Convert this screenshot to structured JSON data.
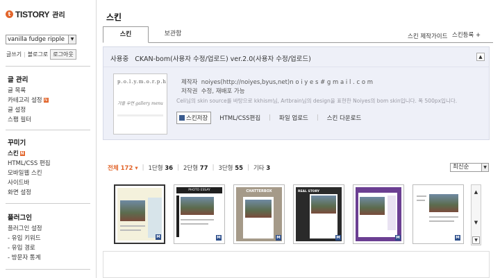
{
  "sidebar": {
    "logo_mark": "t",
    "logo_text": "TISTORY",
    "logo_sub": "관리",
    "blog_select_value": "vanilla fudge ripple",
    "links": [
      "글쓰기",
      "블로그로"
    ],
    "logout_label": "로그아웃",
    "groups": [
      {
        "title": "글 관리",
        "items": [
          "글 목록",
          "카테고리 설정",
          "글 설정",
          "스팸 필터"
        ]
      },
      {
        "title": "꾸미기",
        "items": [
          "스킨",
          "HTML/CSS 편집",
          "모바일웹 스킨",
          "사이드바",
          "화면 설정"
        ]
      },
      {
        "title": "플러그인",
        "items": [
          "플러그인 설정",
          "- 유입 키워드",
          "- 유입 경로",
          "- 방문자 통계"
        ]
      }
    ],
    "new_badge": "N"
  },
  "main": {
    "title": "스킨",
    "tabs": [
      "스킨",
      "보관함"
    ],
    "guide_link": "스킨 제작가이드",
    "register_link": "스킨등록 +",
    "current": {
      "status": "사용중",
      "name": "CKAN-bom(사용자 수정/업로드) ver.2.0(사용자 수정/업로드)",
      "thumb_title": "p.o.l.y.m.o.r.p.h",
      "thumb_sub": "가을 우먼 gallery menu",
      "maker_label": "제작자",
      "maker_value": "noiyes(http://noiyes,byus,net)n o i y e s # g m a i l . c o m",
      "copyright_label": "저작권",
      "copyright_value": "수정, 재배포 가능",
      "description": "Celi님의 skin source를 바탕으로 kkhism님, Artbrain님의 design을 표현한 Noiyes의 bom skin입니다. 폭 500px입니다.",
      "save_label": "스킨저장",
      "actions": [
        "HTML/CSS편집",
        "파일 업로드",
        "스킨 다운로드"
      ]
    },
    "filters": [
      {
        "label": "전체",
        "count": "172"
      },
      {
        "label": "1단형",
        "count": "36"
      },
      {
        "label": "2단형",
        "count": "77"
      },
      {
        "label": "3단형",
        "count": "55"
      },
      {
        "label": "기타",
        "count": "3"
      }
    ],
    "sort_value": "최신순",
    "thumbs": [
      {
        "title": "",
        "bg": "#f4f1dc",
        "side": "#d7e4ea"
      },
      {
        "title": "PHOTO ESSAY",
        "bg": "#ffffff",
        "side": "#1f1f1f"
      },
      {
        "title": "CHATTERBOX",
        "bg": "#a59a89",
        "side": "#a59a89"
      },
      {
        "title": "REAL STORY",
        "bg": "#2a2a2a",
        "side": "#2a2a2a"
      },
      {
        "title": "",
        "bg": "#6b3f92",
        "side": "#6b3f92"
      },
      {
        "title": "",
        "bg": "#ffffff",
        "side": "#ffffff"
      }
    ],
    "thumb_badge": "M"
  }
}
